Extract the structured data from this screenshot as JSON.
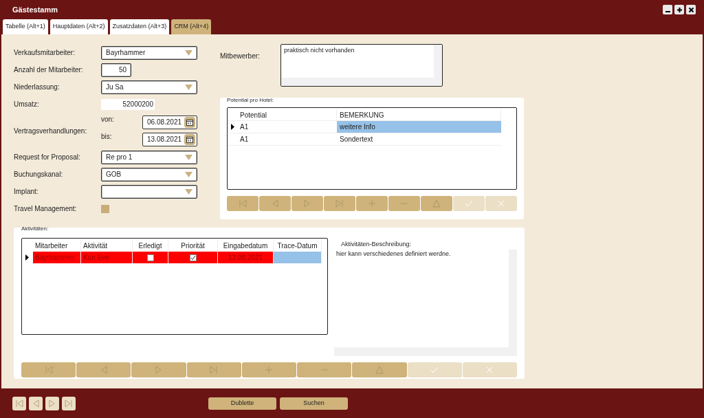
{
  "window": {
    "title": "Gästestamm",
    "controls": [
      {
        "kind": "minimize"
      },
      {
        "kind": "maximize"
      },
      {
        "kind": "close"
      }
    ]
  },
  "tabs": [
    {
      "label": "Tabelle (Alt+1)",
      "selected": false
    },
    {
      "label": "Hauptdaten (Alt+2)",
      "selected": false
    },
    {
      "label": "Zusatzdaten (Alt+3)",
      "selected": false
    },
    {
      "label": "CRM (Alt+4)",
      "selected": true
    }
  ],
  "form": [
    {
      "kind": "dropdown",
      "label": "Verkaufsmitarbeiter:",
      "value": "Bayrhammer"
    },
    {
      "kind": "number",
      "label": "Anzahl der Mitarbeiter:",
      "value": "50"
    },
    {
      "kind": "dropdown",
      "label": "Niederlassung:",
      "value": "Ju Sa"
    },
    {
      "kind": "plain",
      "label": "Umsatz:",
      "value": "52000200"
    },
    {
      "kind": "daterange",
      "label": "Vertragsverhandlungen:",
      "from_label": "von:",
      "from": "06.08.2021",
      "to_label": "bis:",
      "to": "13.08.2021"
    },
    {
      "kind": "dropdown",
      "label": "Request for Proposal:",
      "value": "Re pro 1"
    },
    {
      "kind": "dropdown",
      "label": "Buchungskanal:",
      "value": "GOB"
    },
    {
      "kind": "dropdown",
      "label": "Implant:"
    },
    {
      "kind": "checkbox",
      "label": "Travel Management:",
      "checked": false
    }
  ],
  "competitors": {
    "label": "Mitbewerber:",
    "value": "praktisch nicht vorhanden"
  },
  "potential": {
    "title": "Potential pro Hotel:",
    "columns": [
      "Potential",
      "BEMERKUNG"
    ],
    "rows": [
      {
        "current": true,
        "cells": [
          {
            "text": "A1",
            "selected": false
          },
          {
            "text": "weitere Info",
            "selected": true
          }
        ]
      },
      {
        "current": false,
        "cells": [
          {
            "text": "A1",
            "selected": false
          },
          {
            "text": "Sondertext",
            "selected": false
          }
        ]
      }
    ],
    "nav": [
      {
        "kind": "first",
        "disabled": false
      },
      {
        "kind": "prev",
        "disabled": false
      },
      {
        "kind": "next",
        "disabled": false
      },
      {
        "kind": "last",
        "disabled": false
      },
      {
        "kind": "add",
        "disabled": false
      },
      {
        "kind": "remove",
        "disabled": false
      },
      {
        "kind": "edit",
        "disabled": false
      },
      {
        "kind": "confirm",
        "disabled": true
      },
      {
        "kind": "cancel",
        "disabled": true
      }
    ]
  },
  "activities": {
    "title": "Aktivitäten:",
    "columns": [
      "Mitarbeiter",
      "Aktivität",
      "Erledigt",
      "Priorität",
      "Eingabedatum",
      "Trace-Datum"
    ],
    "rows": [
      {
        "current": true,
        "flagged": true,
        "cells": [
          {
            "kind": "text",
            "text": "Bayrhammer",
            "selected": false
          },
          {
            "kind": "text",
            "text": "Kun Eve",
            "selected": false
          },
          {
            "kind": "check",
            "checked": false,
            "selected": false
          },
          {
            "kind": "check",
            "checked": true,
            "selected": false
          },
          {
            "kind": "date",
            "text": "12.08.2021",
            "selected": false
          },
          {
            "kind": "date",
            "selected": true
          }
        ]
      }
    ],
    "description_label": "Aktivitäten-Beschreibung:",
    "description": "hier kann verschiedenes definiert werdne.",
    "nav": [
      {
        "kind": "first",
        "disabled": false
      },
      {
        "kind": "prev",
        "disabled": false
      },
      {
        "kind": "next",
        "disabled": false
      },
      {
        "kind": "last",
        "disabled": false
      },
      {
        "kind": "add",
        "disabled": false
      },
      {
        "kind": "remove",
        "disabled": false
      },
      {
        "kind": "edit",
        "disabled": false
      },
      {
        "kind": "confirm",
        "disabled": true
      },
      {
        "kind": "cancel",
        "disabled": true
      }
    ]
  },
  "footer": {
    "nav": [
      {
        "kind": "first",
        "disabled": false
      },
      {
        "kind": "prev",
        "disabled": false
      },
      {
        "kind": "next",
        "disabled": false
      },
      {
        "kind": "last",
        "disabled": false
      }
    ],
    "buttons": [
      "Dublette",
      "Suchen"
    ]
  }
}
